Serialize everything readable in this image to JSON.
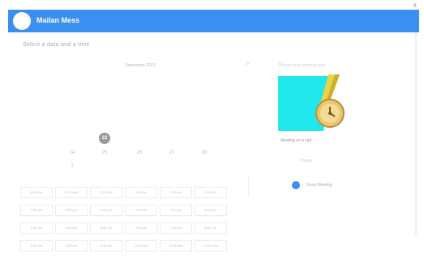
{
  "header": {
    "app_title": "Mailan Mess",
    "close_glyph": "x",
    "brand_color": "#3b8ff0"
  },
  "booking": {
    "subtitle": "Select a date and a time"
  },
  "calendar": {
    "month_label": "September 2021",
    "next_glyph": ">",
    "dates_row1": [
      "22",
      "",
      "",
      "",
      ""
    ],
    "dates_row2": [
      "24",
      "25",
      "26",
      "27",
      "28"
    ],
    "dates_row3": [
      "1"
    ],
    "selected_date": "22"
  },
  "time_slots": [
    "11:30 am",
    "12:00 pm",
    "12:30 pm",
    "1:00 pm",
    "1:30 pm",
    "2:00 pm",
    "2:30 pm",
    "3:00 pm",
    "3:30 pm",
    "4:00 pm",
    "4:30 pm",
    "5:00 pm",
    "5:30 pm",
    "6:00 pm",
    "6:30 pm",
    "7:00 pm",
    "7:30 pm",
    "8:00 pm",
    "8:30 pm",
    "9:00 pm",
    "9:30 pm",
    "10:00 pm",
    "10:30 pm",
    "11:00 pm"
  ],
  "meeting": {
    "title": "Choose your meeting type",
    "caption": "Meeting on a call",
    "option_label": "Phone",
    "zoom_label": "Zoom Meeting",
    "illustration_icon": "clock-pencil-illustration"
  }
}
